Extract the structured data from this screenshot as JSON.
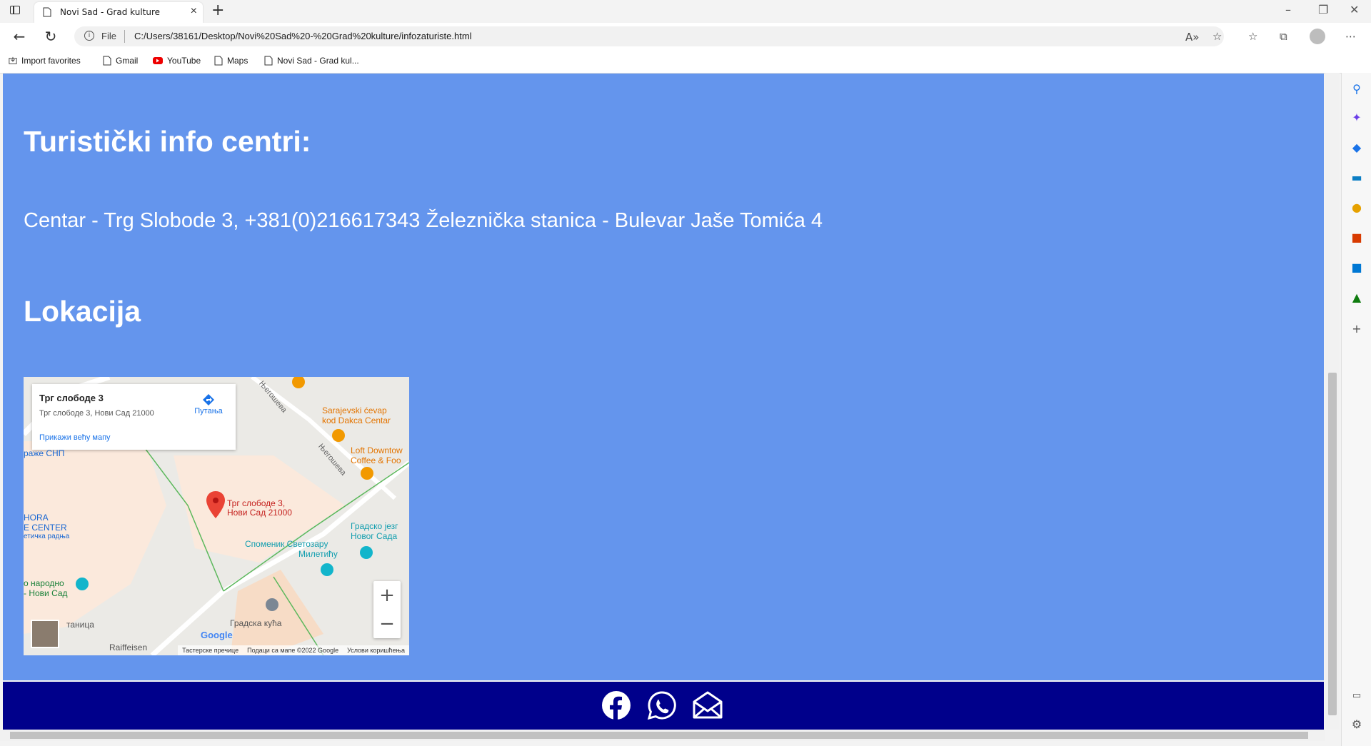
{
  "browser": {
    "tab_title": "Novi Sad - Grad kulture",
    "new_tab": "+",
    "url_scheme": "File",
    "url": "C:/Users/38161/Desktop/Novi%20Sad%20-%20Grad%20kulture/infozaturiste.html",
    "favorites": [
      "Import favorites",
      "Gmail",
      "YouTube",
      "Maps",
      "Novi Sad - Grad kul..."
    ]
  },
  "page": {
    "heading_info": "Turistički info centri:",
    "info_text": "Centar - Trg Slobode 3, +381(0)216617343 Železnička stanica - Bulevar Jaše Tomića 4",
    "heading_location": "Lokacija",
    "background_color": "#6495ed",
    "footer_color": "#00008b"
  },
  "map": {
    "card_title": "Трг слободе 3",
    "card_address": "Трг слободе 3, Нови Сад 21000",
    "card_directions": "Путања",
    "card_larger_map": "Прикажи већу мапу",
    "pin_label_1": "Трг слободе 3,",
    "pin_label_2": "Нови Сад 21000",
    "labels": [
      "Sarajevski ćevap",
      "kod Dakca Centar",
      "Loft Downtow",
      "Coffee & Foo",
      "Његошева",
      "Његошева",
      "Градско језг",
      "Новог Сада",
      "Споменик Светозару",
      "Милетићу",
      "Градска кућа",
      "Raiffeisen",
      "раже СНП",
      "HORA",
      "E CENTER",
      "етичка радња",
      "о народно",
      "- Нови Сад",
      "таница"
    ],
    "zoom_in": "+",
    "zoom_out": "−",
    "footer_shortcuts": "Тастерске пречице",
    "footer_data": "Подаци са мапе ©2022 Google",
    "footer_terms": "Услови коришћења",
    "google": "Google"
  },
  "footer_icons": [
    "facebook-icon",
    "whatsapp-icon",
    "mail-icon"
  ]
}
